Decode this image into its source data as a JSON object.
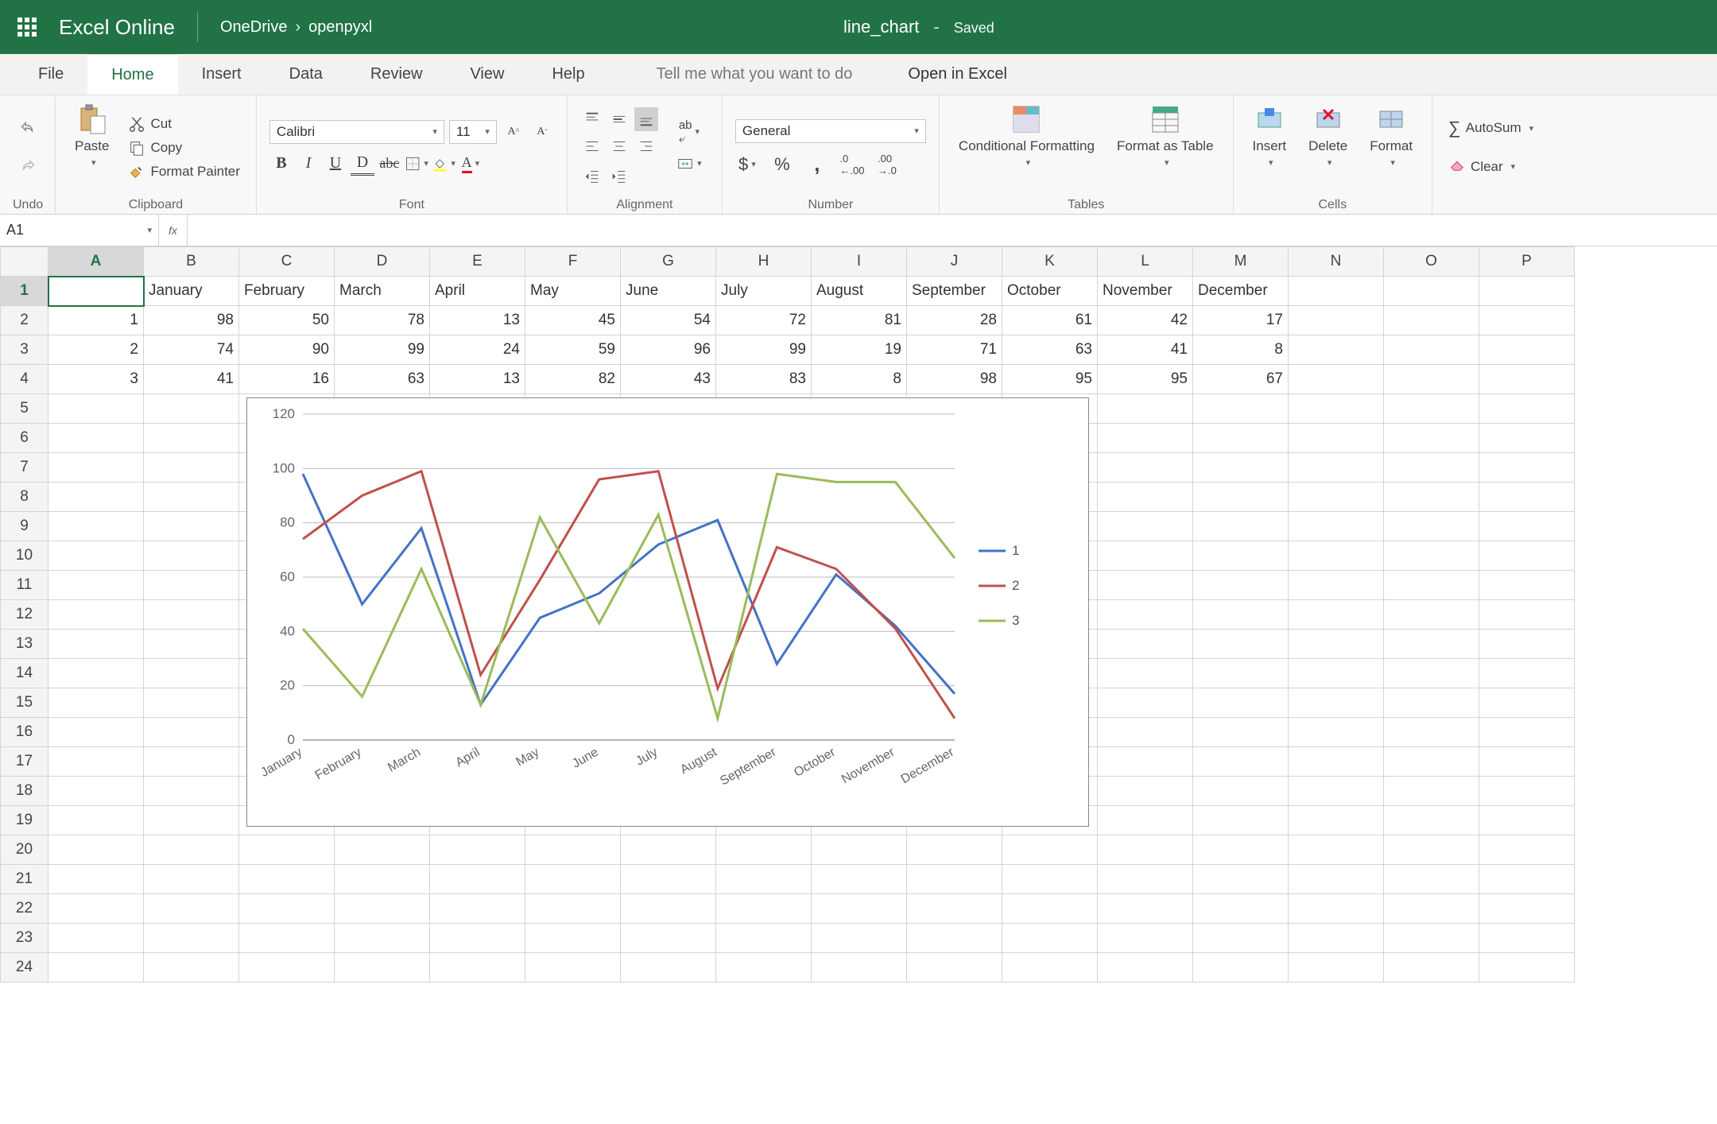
{
  "titlebar": {
    "app": "Excel Online",
    "breadcrumb": [
      "OneDrive",
      "openpyxl"
    ],
    "docname": "line_chart",
    "status": "Saved"
  },
  "menu": {
    "tabs": [
      "File",
      "Home",
      "Insert",
      "Data",
      "Review",
      "View",
      "Help"
    ],
    "active": "Home",
    "tellme": "Tell me what you want to do",
    "open_in": "Open in Excel"
  },
  "ribbon": {
    "undo_label": "Undo",
    "clipboard": {
      "paste": "Paste",
      "cut": "Cut",
      "copy": "Copy",
      "painter": "Format Painter",
      "group": "Clipboard"
    },
    "font": {
      "name": "Calibri",
      "size": "11",
      "group": "Font"
    },
    "alignment": {
      "group": "Alignment"
    },
    "number": {
      "format": "General",
      "group": "Number"
    },
    "tables": {
      "cond": "Conditional Formatting",
      "table": "Format as Table",
      "group": "Tables"
    },
    "cells": {
      "insert": "Insert",
      "delete": "Delete",
      "format": "Format",
      "group": "Cells"
    },
    "editing": {
      "autosum": "AutoSum",
      "clear": "Clear"
    }
  },
  "formula_bar": {
    "cell_ref": "A1",
    "formula": ""
  },
  "sheet": {
    "columns": [
      "A",
      "B",
      "C",
      "D",
      "E",
      "F",
      "G",
      "H",
      "I",
      "J",
      "K",
      "L",
      "M",
      "N",
      "O",
      "P"
    ],
    "row_count": 24,
    "months": [
      "January",
      "February",
      "March",
      "April",
      "May",
      "June",
      "July",
      "August",
      "September",
      "October",
      "November",
      "December"
    ],
    "rows": [
      {
        "id": "1",
        "v": [
          98,
          50,
          78,
          13,
          45,
          54,
          72,
          81,
          28,
          61,
          42,
          17
        ]
      },
      {
        "id": "2",
        "v": [
          74,
          90,
          99,
          24,
          59,
          96,
          99,
          19,
          71,
          63,
          41,
          8
        ]
      },
      {
        "id": "3",
        "v": [
          41,
          16,
          63,
          13,
          82,
          43,
          83,
          8,
          98,
          95,
          95,
          67
        ]
      }
    ],
    "selected_cell": "A1"
  },
  "chart_data": {
    "type": "line",
    "categories": [
      "January",
      "February",
      "March",
      "April",
      "May",
      "June",
      "July",
      "August",
      "September",
      "October",
      "November",
      "December"
    ],
    "series": [
      {
        "name": "1",
        "color": "#4472C4",
        "values": [
          98,
          50,
          78,
          13,
          45,
          54,
          72,
          81,
          28,
          61,
          42,
          17
        ]
      },
      {
        "name": "2",
        "color": "#C0504D",
        "values": [
          74,
          90,
          99,
          24,
          59,
          96,
          99,
          19,
          71,
          63,
          41,
          8
        ]
      },
      {
        "name": "3",
        "color": "#9BBB59",
        "values": [
          41,
          16,
          63,
          13,
          82,
          43,
          83,
          8,
          98,
          95,
          95,
          67
        ]
      }
    ],
    "ylim": [
      0,
      120
    ],
    "ytick": 20,
    "legend_position": "right"
  }
}
